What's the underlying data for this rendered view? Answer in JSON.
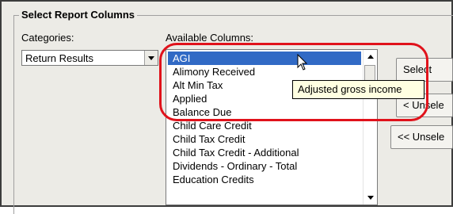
{
  "group": {
    "title": "Select Report Columns"
  },
  "categories": {
    "label": "Categories:",
    "selected": "Return Results"
  },
  "available": {
    "label": "Available Columns:",
    "items": [
      "AGI",
      "Alimony Received",
      "Alt Min Tax",
      "Applied",
      "Balance Due",
      "Child Care Credit",
      "Child Tax Credit",
      "Child Tax Credit - Additional",
      "Dividends - Ordinary - Total",
      "Education Credits"
    ],
    "selected_index": 0
  },
  "buttons": {
    "select": "Select",
    "unselect": "< Unsele",
    "unselect_all": "<< Unsele"
  },
  "tooltip": {
    "text": "Adjusted gross income"
  },
  "colors": {
    "highlight": "#e0121b",
    "selection": "#316ac5",
    "tooltip_bg": "#ffffe1"
  },
  "icons": {
    "dropdown": "chevron-down-icon",
    "scroll_up": "scroll-up-arrow-icon",
    "scroll_down": "scroll-down-arrow-icon",
    "cursor": "mouse-pointer-icon"
  }
}
